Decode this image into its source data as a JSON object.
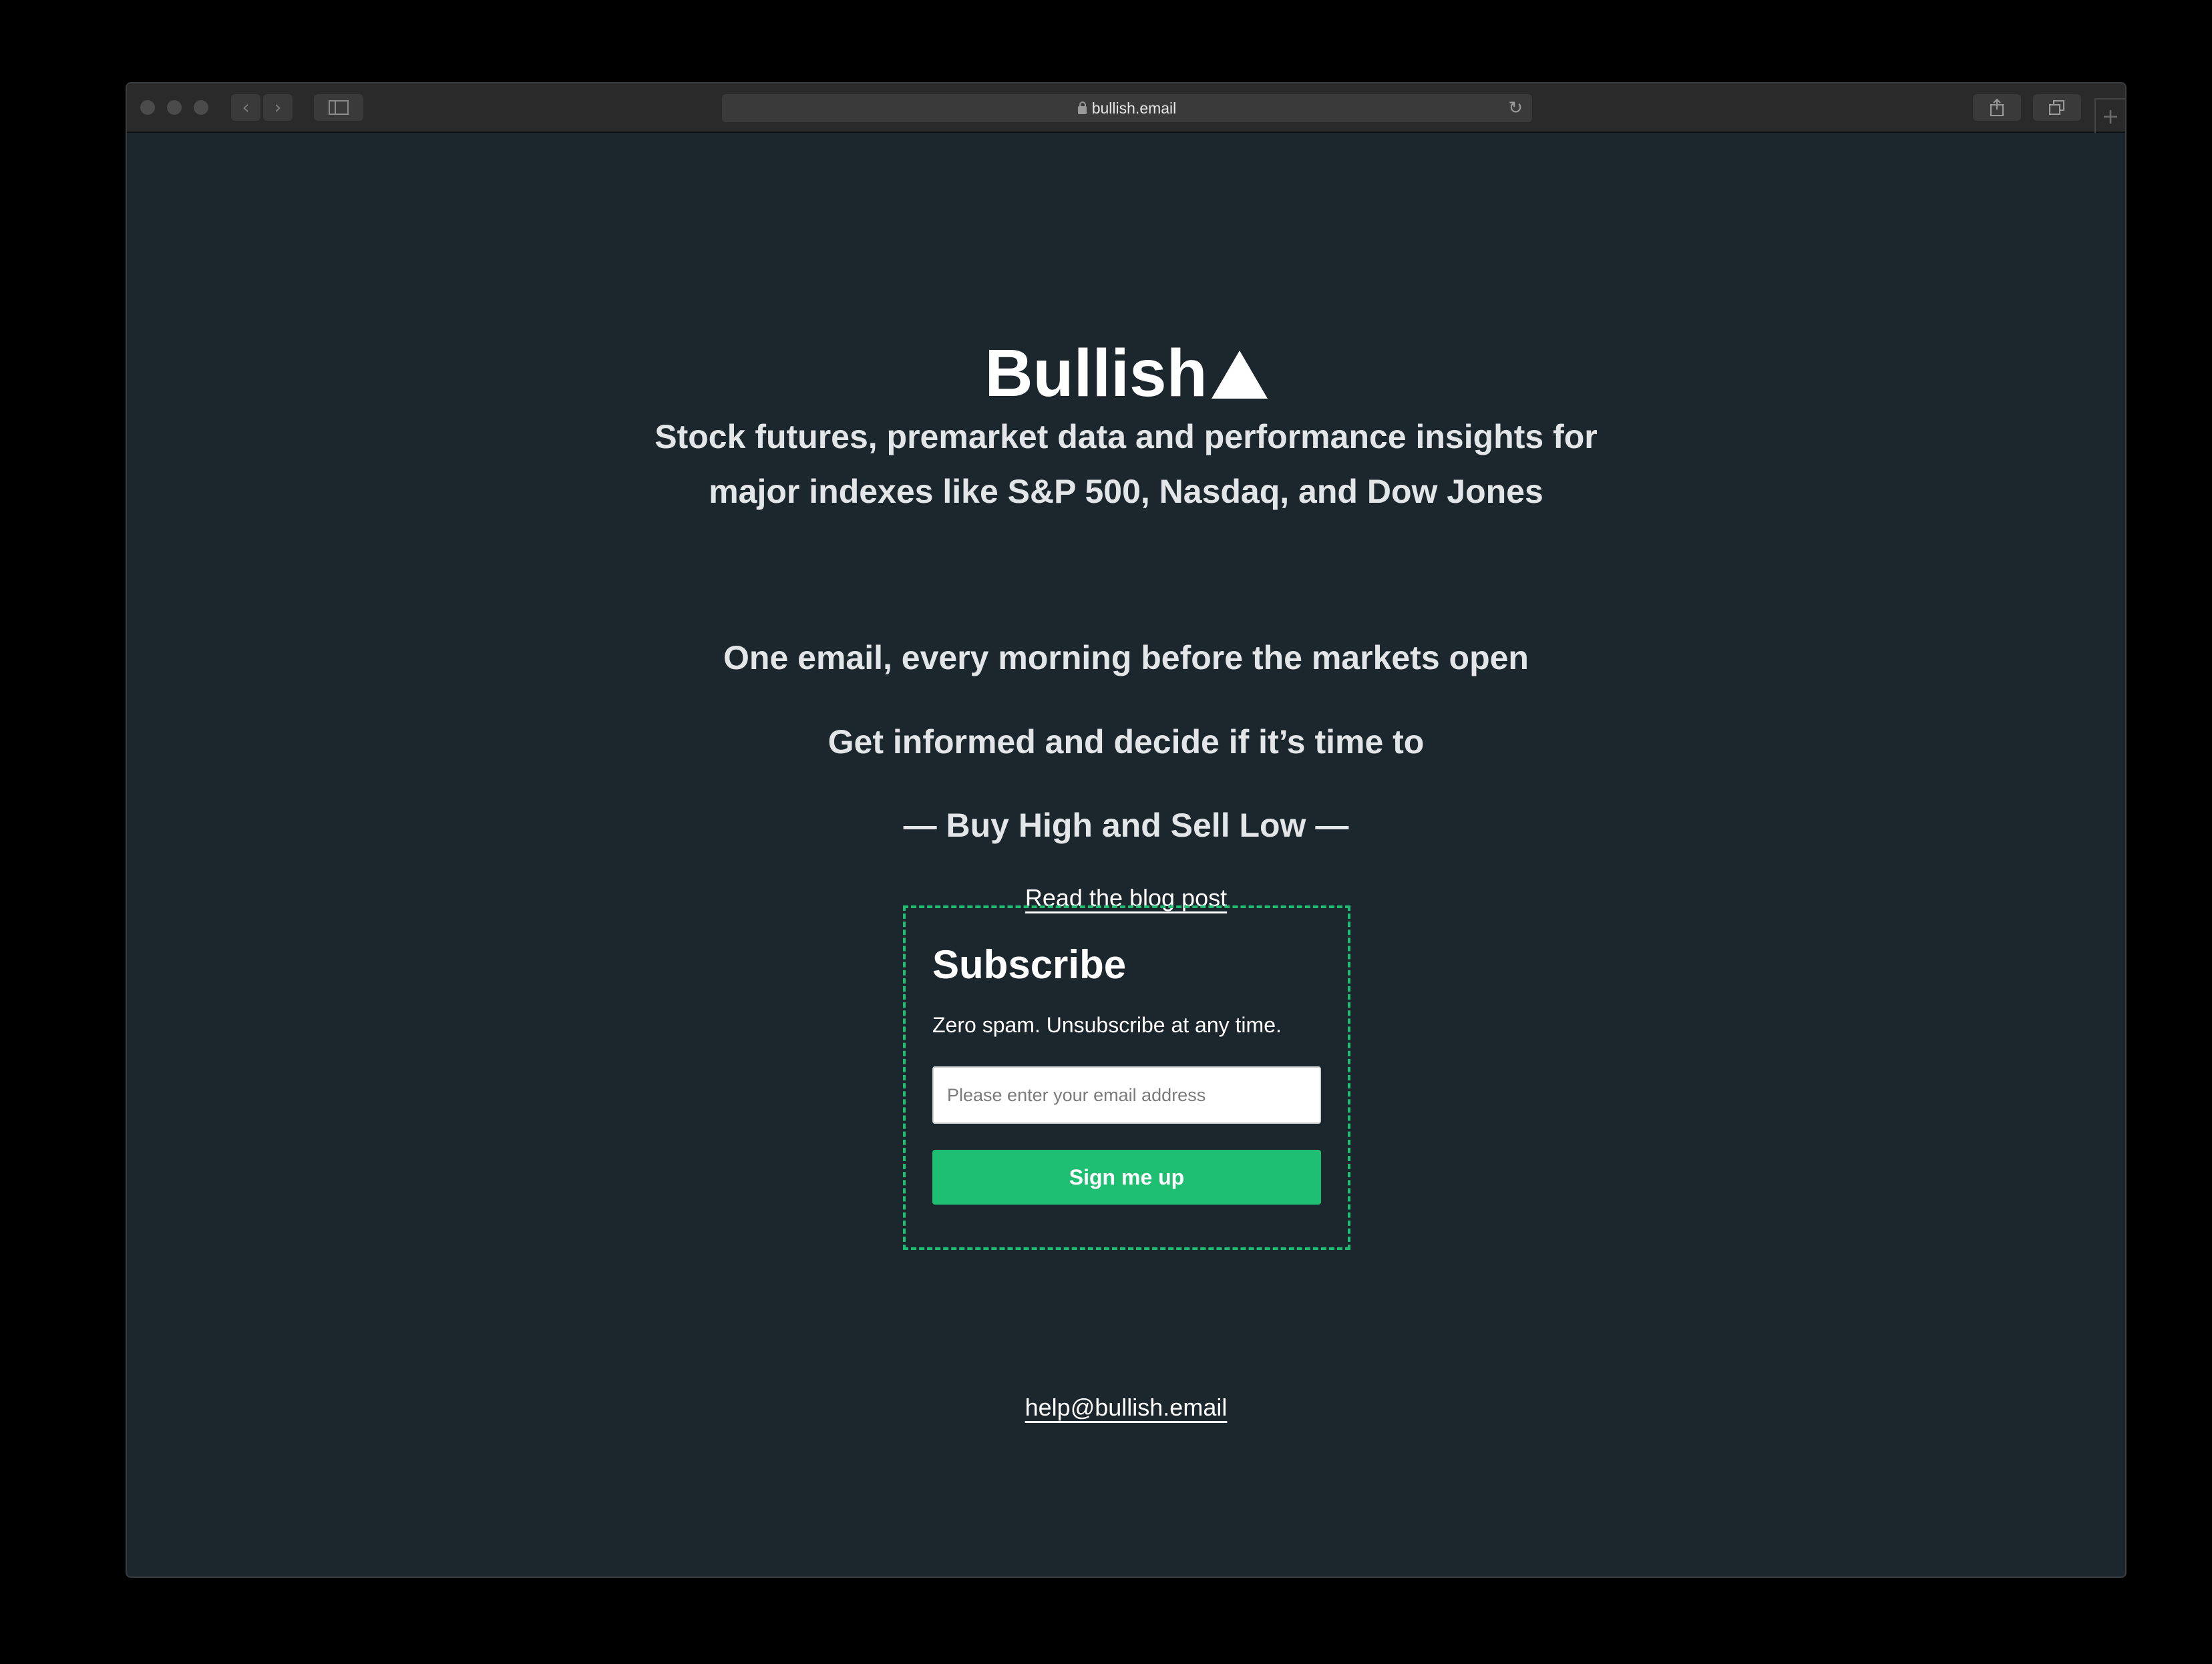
{
  "browser": {
    "url": "bullish.email",
    "back_icon": "chevron-left-icon",
    "forward_icon": "chevron-right-icon",
    "sidebar_icon": "sidebar-icon",
    "reload_icon": "reload-icon",
    "share_icon": "share-icon",
    "tabs_icon": "tabs-icon",
    "new_tab_icon": "plus-icon"
  },
  "page": {
    "logo_text": "Bullish",
    "logo_icon": "triangle-up-icon",
    "tagline_line1": "Stock futures, premarket data and performance insights for",
    "tagline_line2": "major indexes like S&P 500, Nasdaq, and Dow Jones",
    "tagline_email": "One email, every morning before the markets open",
    "tagline_decide": "Get informed and decide if it’s time to",
    "tagline_motto": "— Buy High and Sell Low —",
    "blog_link": "Read the blog post",
    "help_email": "help@bullish.email"
  },
  "subscribe": {
    "title": "Subscribe",
    "subtitle": "Zero spam. Unsubscribe at any time.",
    "email_placeholder": "Please enter your email address",
    "email_value": "",
    "button_label": "Sign me up"
  },
  "colors": {
    "page_background": "#1c262d",
    "accent_green": "#1fbf73",
    "text_light": "#e3e6e8"
  }
}
